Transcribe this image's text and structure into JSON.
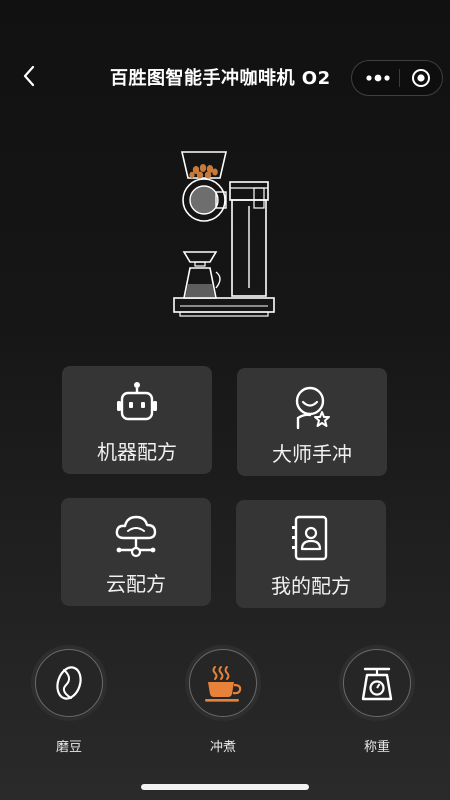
{
  "header": {
    "title": "百胜图智能手冲咖啡机 O2",
    "back_icon": "chevron-left-icon",
    "more_icon": "more-dots-icon",
    "close_icon": "target-close-icon"
  },
  "hero": {
    "image": "coffee-machine-illustration"
  },
  "recipe_cards": [
    {
      "label": "机器配方",
      "icon": "robot-icon"
    },
    {
      "label": "大师手冲",
      "icon": "master-barista-icon"
    },
    {
      "label": "云配方",
      "icon": "cloud-network-icon"
    },
    {
      "label": "我的配方",
      "icon": "contact-card-icon"
    }
  ],
  "modes": [
    {
      "label": "磨豆",
      "icon": "coffee-bean-icon",
      "active": false
    },
    {
      "label": "冲煮",
      "icon": "coffee-cup-icon",
      "active": true
    },
    {
      "label": "称重",
      "icon": "scale-icon",
      "active": false
    }
  ],
  "colors": {
    "accent": "#E8823A",
    "card_bg": "#353535",
    "text": "#FFFFFF"
  }
}
